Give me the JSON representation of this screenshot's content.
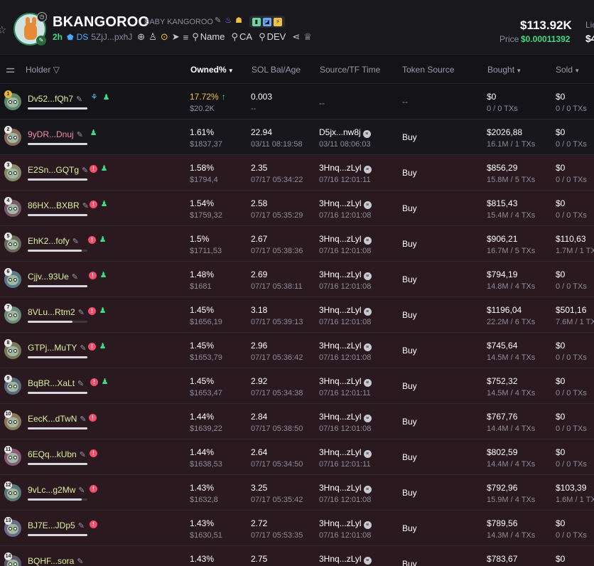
{
  "token": {
    "symbol": "BKANGOROO",
    "name": "BABY KANGOROO",
    "age": "2h",
    "ds_label": "DS",
    "ca_short": "5ZjJ...pxhJ",
    "search_links": [
      "Name",
      "CA",
      "DEV"
    ],
    "market_cap": "$113.92K",
    "price_label": "Price",
    "price_value": "$0.00011392",
    "liq_label": "Lic",
    "liq_value": "$4"
  },
  "columns": {
    "holder": "Holder",
    "owned": "Owned%",
    "sol": "SOL Bal/Age",
    "source": "Source/TF Time",
    "token_source": "Token Source",
    "bought": "Bought",
    "sold": "Sold"
  },
  "rows": [
    {
      "rank": "1",
      "addr": "Dv52...fQh7",
      "owned": "17.72%",
      "owned_usd": "$20.2K",
      "sol": "0.003",
      "age": "--",
      "src": "--",
      "src_time": "",
      "token_source": "--",
      "bought": "$0",
      "bought_sub": "0 / 0 TXs",
      "sold": "$0",
      "sold_sub": "0 / 0 TXs",
      "progress": 1.0
    },
    {
      "rank": "2",
      "addr": "9yDR...Dnuj",
      "owned": "1.61%",
      "owned_usd": "$1837,37",
      "sol": "22.94",
      "age": "03/11 08:19:58",
      "src": "D5jx...nw8j",
      "src_time": "03/11 08:06:03",
      "token_source": "Buy",
      "bought": "$2026,88",
      "bought_sub": "16.1M / 1 TXs",
      "sold": "$0",
      "sold_sub": "0 / 0 TXs",
      "progress": 1.0
    },
    {
      "rank": "3",
      "addr": "E2Sn...GQTg",
      "owned": "1.58%",
      "owned_usd": "$1794,4",
      "sol": "2.35",
      "age": "07/17 05:34:22",
      "src": "3Hnq...zLyl",
      "src_time": "07/16 12:01:11",
      "token_source": "Buy",
      "bought": "$856,29",
      "bought_sub": "15.8M / 5 TXs",
      "sold": "$0",
      "sold_sub": "0 / 0 TXs",
      "progress": 1.0
    },
    {
      "rank": "4",
      "addr": "86HX...BXBR",
      "owned": "1.54%",
      "owned_usd": "$1759,32",
      "sol": "2.58",
      "age": "07/17 05:35:29",
      "src": "3Hnq...zLyl",
      "src_time": "07/16 12:01:08",
      "token_source": "Buy",
      "bought": "$815,43",
      "bought_sub": "15.4M / 4 TXs",
      "sold": "$0",
      "sold_sub": "0 / 0 TXs",
      "progress": 1.0
    },
    {
      "rank": "5",
      "addr": "EhK2...fofy",
      "owned": "1.5%",
      "owned_usd": "$1711,53",
      "sol": "2.67",
      "age": "07/17 05:38:36",
      "src": "3Hnq...zLyl",
      "src_time": "07/16 12:01:08",
      "token_source": "Buy",
      "bought": "$906,21",
      "bought_sub": "16.7M / 5 TXs",
      "sold": "$110,63",
      "sold_sub": "1.7M / 1 TX",
      "progress": 0.9
    },
    {
      "rank": "6",
      "addr": "Cjjv...93Ue",
      "owned": "1.48%",
      "owned_usd": "$1681",
      "sol": "2.69",
      "age": "07/17 05:38:11",
      "src": "3Hnq...zLyl",
      "src_time": "07/16 12:01:08",
      "token_source": "Buy",
      "bought": "$794,19",
      "bought_sub": "14.8M / 4 TXs",
      "sold": "$0",
      "sold_sub": "0 / 0 TXs",
      "progress": 1.0
    },
    {
      "rank": "7",
      "addr": "8VLu...Rtm2",
      "owned": "1.45%",
      "owned_usd": "$1656,19",
      "sol": "3.18",
      "age": "07/17 05:39:13",
      "src": "3Hnq...zLyl",
      "src_time": "07/16 12:01:08",
      "token_source": "Buy",
      "bought": "$1196,04",
      "bought_sub": "22.2M / 6 TXs",
      "sold": "$501,16",
      "sold_sub": "7.6M / 1 TX",
      "progress": 0.75
    },
    {
      "rank": "8",
      "addr": "GTPj...MuTY",
      "owned": "1.45%",
      "owned_usd": "$1653,79",
      "sol": "2.96",
      "age": "07/17 05:36:42",
      "src": "3Hnq...zLyl",
      "src_time": "07/16 12:01:08",
      "token_source": "Buy",
      "bought": "$745,64",
      "bought_sub": "14.5M / 4 TXs",
      "sold": "$0",
      "sold_sub": "0 / 0 TXs",
      "progress": 1.0
    },
    {
      "rank": "9",
      "addr": "BqBR...XaLt",
      "owned": "1.45%",
      "owned_usd": "$1653,47",
      "sol": "2.92",
      "age": "07/17 05:34:38",
      "src": "3Hnq...zLyl",
      "src_time": "07/16 12:01:11",
      "token_source": "Buy",
      "bought": "$752,32",
      "bought_sub": "14.5M / 4 TXs",
      "sold": "$0",
      "sold_sub": "0 / 0 TXs",
      "progress": 1.0
    },
    {
      "rank": "10",
      "addr": "EecK...dTwN",
      "owned": "1.44%",
      "owned_usd": "$1639,22",
      "sol": "2.84",
      "age": "07/17 05:38:50",
      "src": "3Hnq...zLyl",
      "src_time": "07/16 12:01:08",
      "token_source": "Buy",
      "bought": "$767,76",
      "bought_sub": "14.4M / 4 TXs",
      "sold": "$0",
      "sold_sub": "0 / 0 TXs",
      "progress": 1.0
    },
    {
      "rank": "11",
      "addr": "6EQq...kUbn",
      "owned": "1.44%",
      "owned_usd": "$1638,53",
      "sol": "2.64",
      "age": "07/17 05:34:50",
      "src": "3Hnq...zLyl",
      "src_time": "07/16 12:01:11",
      "token_source": "Buy",
      "bought": "$802,59",
      "bought_sub": "14.4M / 4 TXs",
      "sold": "$0",
      "sold_sub": "0 / 0 TXs",
      "progress": 1.0
    },
    {
      "rank": "12",
      "addr": "9vLc...g2Mw",
      "owned": "1.43%",
      "owned_usd": "$1632,8",
      "sol": "3.25",
      "age": "07/17 05:35:42",
      "src": "3Hnq...zLyl",
      "src_time": "07/16 12:01:08",
      "token_source": "Buy",
      "bought": "$792,96",
      "bought_sub": "15.9M / 4 TXs",
      "sold": "$103,39",
      "sold_sub": "1.6M / 1 TX",
      "progress": 0.9
    },
    {
      "rank": "13",
      "addr": "BJ7E...JDp5",
      "owned": "1.43%",
      "owned_usd": "$1630,51",
      "sol": "2.72",
      "age": "07/17 05:53:35",
      "src": "3Hnq...zLyl",
      "src_time": "07/16 12:01:08",
      "token_source": "Buy",
      "bought": "$789,56",
      "bought_sub": "14.3M / 4 TXs",
      "sold": "$0",
      "sold_sub": "0 / 0 TXs",
      "progress": 1.0
    },
    {
      "rank": "14",
      "addr": "BQHF...sora",
      "owned": "1.43%",
      "owned_usd": "",
      "sol": "2.75",
      "age": "",
      "src": "3Hnq...zLyl",
      "src_time": "",
      "token_source": "Buy",
      "bought": "$783,67",
      "bought_sub": "",
      "sold": "$0",
      "sold_sub": "",
      "progress": 1.0
    }
  ]
}
